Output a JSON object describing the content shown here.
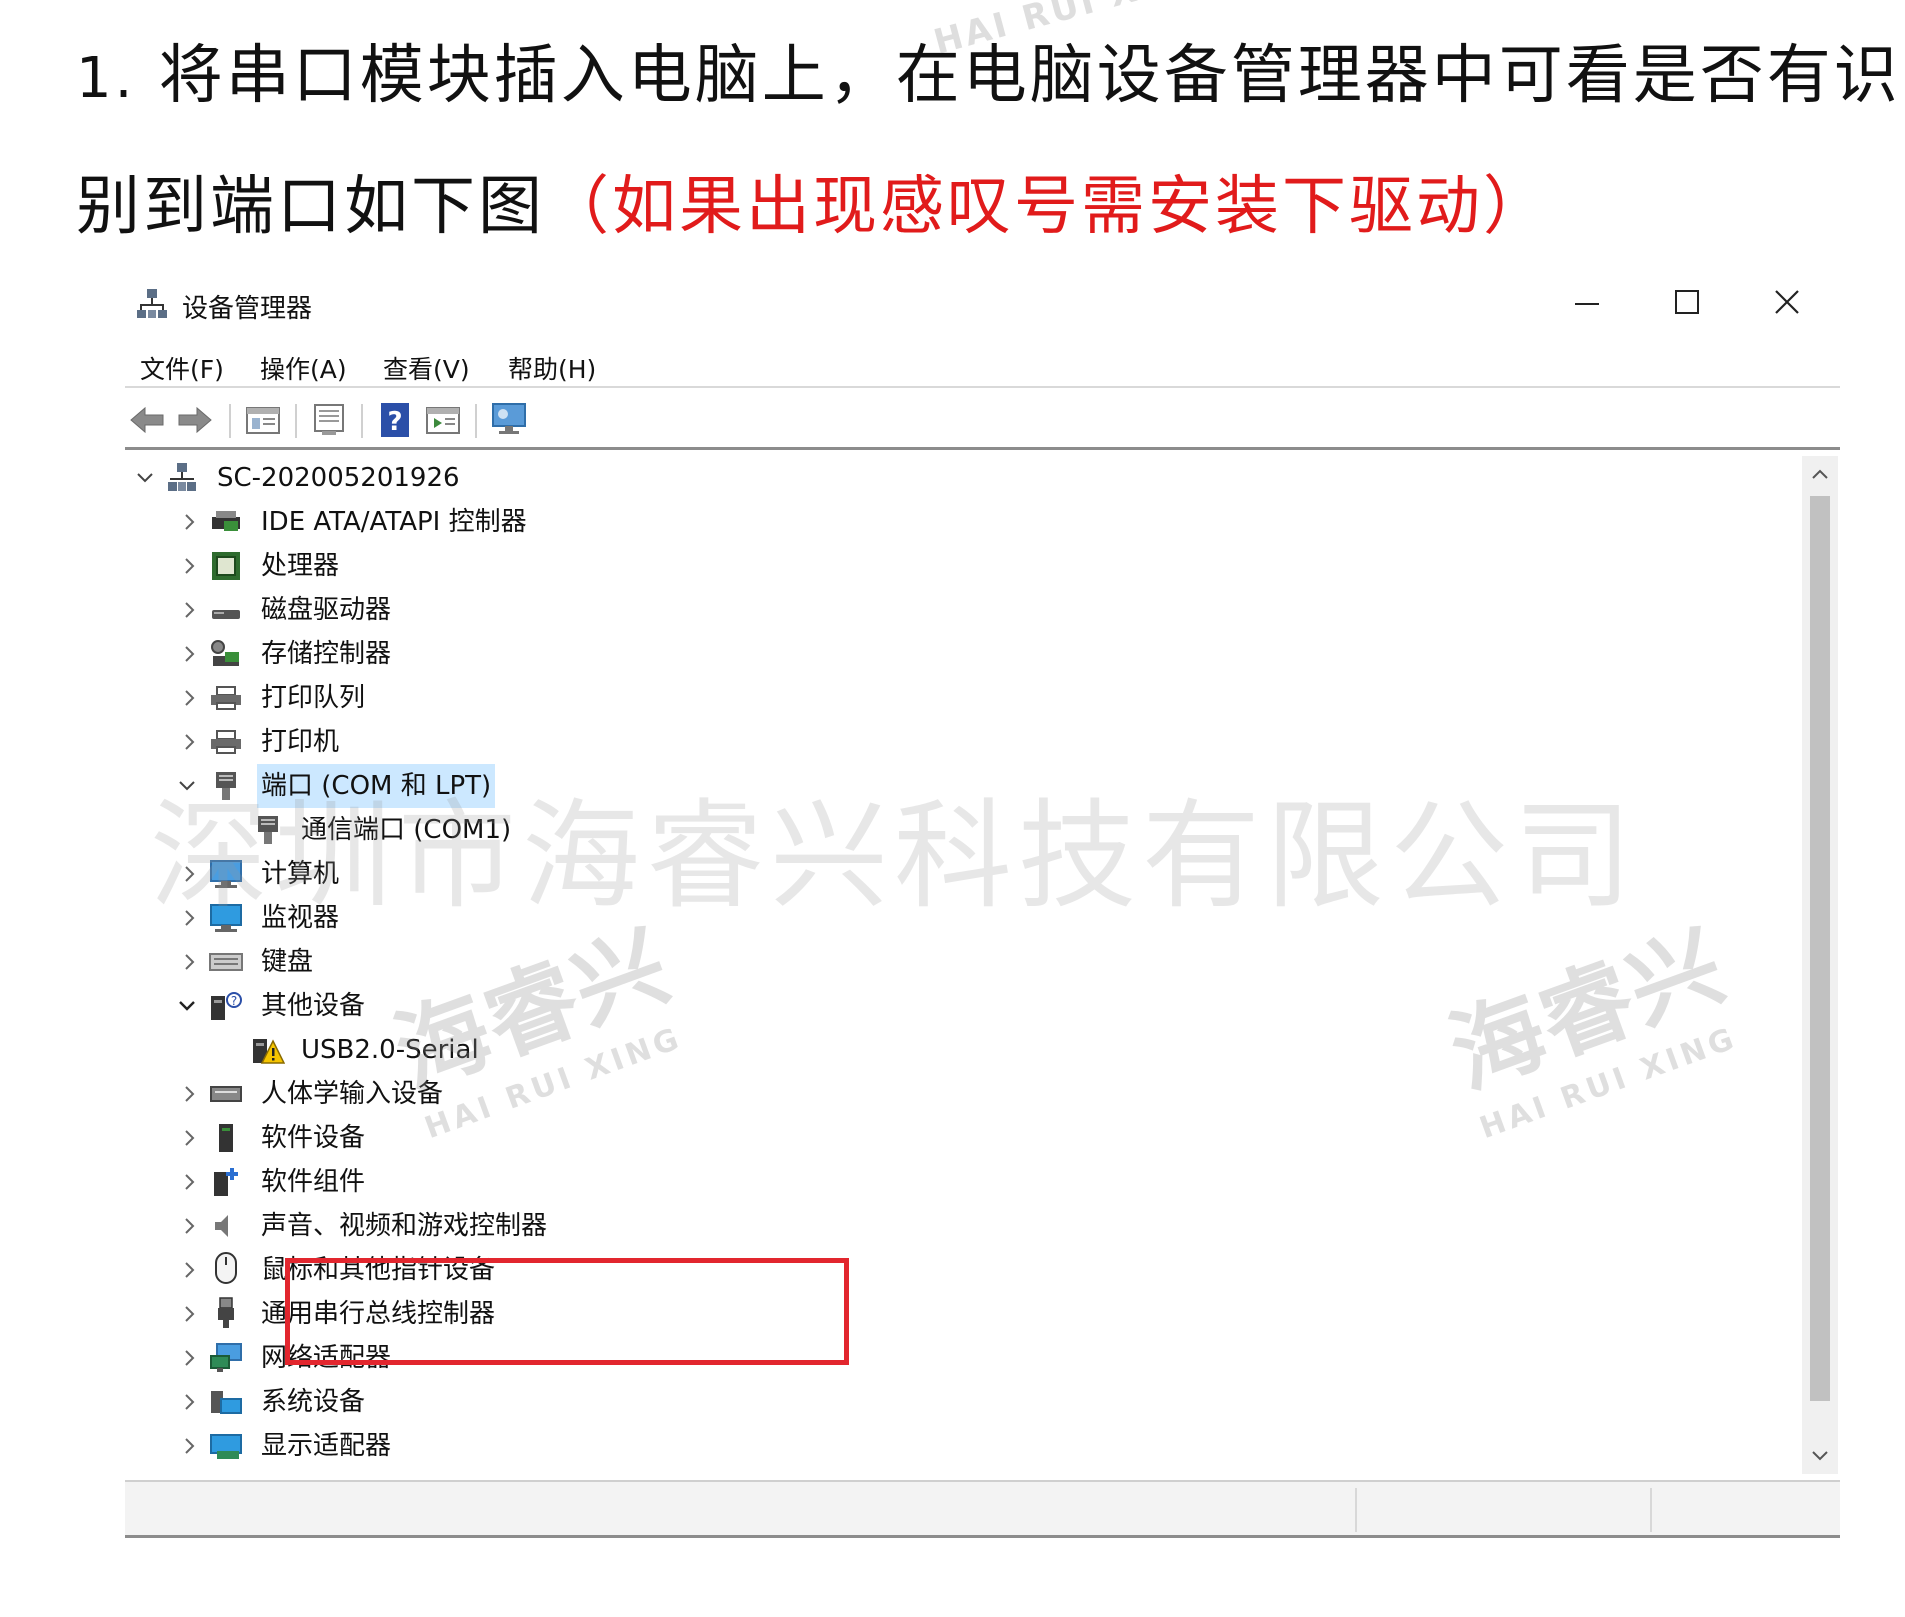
{
  "instruction": {
    "number": "1.",
    "line1": "将串口模块插入电脑上，在电脑设备管理器中可看是否有识",
    "line2": "别到端口如下图",
    "note": "（如果出现感叹号需安装下驱动）",
    "note_color": "#e11b1b"
  },
  "window": {
    "title": "设备管理器",
    "icons": {
      "app": "device-manager-icon",
      "minimize": "minimize-icon",
      "maximize": "maximize-icon",
      "close": "close-icon"
    }
  },
  "menu": [
    "文件(F)",
    "操作(A)",
    "查看(V)",
    "帮助(H)"
  ],
  "toolbar": [
    "back-icon",
    "forward-icon",
    "properties-icon",
    "show-hide-icon",
    "help-icon",
    "update-driver-icon",
    "scan-hardware-icon"
  ],
  "tree": {
    "root": "SC-202005201926",
    "items": [
      {
        "label": "IDE ATA/ATAPI 控制器",
        "icon": "ide-controller-icon",
        "expanded": false
      },
      {
        "label": "处理器",
        "icon": "processor-icon",
        "expanded": false
      },
      {
        "label": "磁盘驱动器",
        "icon": "disk-drive-icon",
        "expanded": false
      },
      {
        "label": "存储控制器",
        "icon": "storage-controller-icon",
        "expanded": false
      },
      {
        "label": "打印队列",
        "icon": "print-queue-icon",
        "expanded": false
      },
      {
        "label": "打印机",
        "icon": "printer-icon",
        "expanded": false
      },
      {
        "label": "端口 (COM 和 LPT)",
        "icon": "port-icon",
        "expanded": true,
        "selected": true
      },
      {
        "label": "通信端口 (COM1)",
        "icon": "com-port-icon",
        "child": true
      },
      {
        "label": "计算机",
        "icon": "computer-icon",
        "expanded": false
      },
      {
        "label": "监视器",
        "icon": "monitor-icon",
        "expanded": false
      },
      {
        "label": "键盘",
        "icon": "keyboard-icon",
        "expanded": false
      },
      {
        "label": "其他设备",
        "icon": "other-devices-icon",
        "expanded": true
      },
      {
        "label": "USB2.0-Serial",
        "icon": "usb-serial-warning-icon",
        "child": true
      },
      {
        "label": "人体学输入设备",
        "icon": "hid-icon",
        "expanded": false
      },
      {
        "label": "软件设备",
        "icon": "software-device-icon",
        "expanded": false
      },
      {
        "label": "软件组件",
        "icon": "software-component-icon",
        "expanded": false
      },
      {
        "label": "声音、视频和游戏控制器",
        "icon": "sound-icon",
        "expanded": false
      },
      {
        "label": "鼠标和其他指针设备",
        "icon": "mouse-icon",
        "expanded": false
      },
      {
        "label": "通用串行总线控制器",
        "icon": "usb-controller-icon",
        "expanded": false
      },
      {
        "label": "网络适配器",
        "icon": "network-adapter-icon",
        "expanded": false
      },
      {
        "label": "系统设备",
        "icon": "system-devices-icon",
        "expanded": false
      },
      {
        "label": "显示适配器",
        "icon": "display-adapter-icon",
        "expanded": false
      }
    ]
  },
  "watermark": {
    "company": "深圳市海睿兴科技有限公司",
    "brand": "海睿兴",
    "brand_en": "HAI RUI XING"
  }
}
